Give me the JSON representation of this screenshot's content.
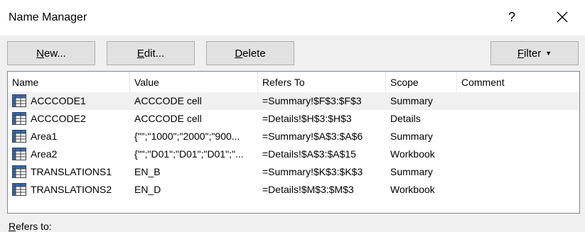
{
  "dialog": {
    "title": "Name Manager",
    "help": "?"
  },
  "buttons": {
    "new_pre": "",
    "new_key": "N",
    "new_post": "ew...",
    "edit_pre": "",
    "edit_key": "E",
    "edit_post": "dit...",
    "delete_pre": "",
    "delete_key": "D",
    "delete_post": "elete",
    "filter_pre": "",
    "filter_key": "F",
    "filter_post": "ilter"
  },
  "table": {
    "columns": [
      "Name",
      "Value",
      "Refers To",
      "Scope",
      "Comment"
    ],
    "rows": [
      {
        "name": "ACCCODE1",
        "value": "ACCCODE cell",
        "refers_to": "=Summary!$F$3:$F$3",
        "scope": "Summary",
        "comment": "",
        "selected": true
      },
      {
        "name": "ACCCODE2",
        "value": "ACCCODE cell",
        "refers_to": "=Details!$H$3:$H$3",
        "scope": "Details",
        "comment": ""
      },
      {
        "name": "Area1",
        "value": "{\"\";\"1000\";\"2000\";\"900...",
        "refers_to": "=Summary!$A$3:$A$6",
        "scope": "Summary",
        "comment": ""
      },
      {
        "name": "Area2",
        "value": "{\"\";\"D01\";\"D01\";\"D01\";\"...",
        "refers_to": "=Details!$A$3:$A$15",
        "scope": "Workbook",
        "comment": ""
      },
      {
        "name": "TRANSLATIONS1",
        "value": "EN_B",
        "refers_to": "=Summary!$K$3:$K$3",
        "scope": "Summary",
        "comment": ""
      },
      {
        "name": "TRANSLATIONS2",
        "value": "EN_D",
        "refers_to": "=Details!$M$3:$M$3",
        "scope": "Workbook",
        "comment": ""
      }
    ]
  },
  "footer": {
    "refers_to_label": "Refers to:"
  },
  "icons": {
    "table_icon_color": "#2b6cc4"
  }
}
